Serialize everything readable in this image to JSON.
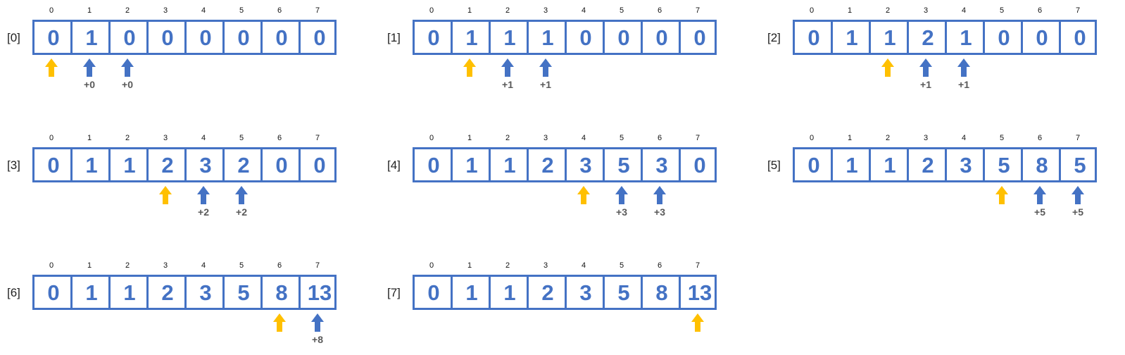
{
  "colors": {
    "array_border": "#4472c4",
    "value_text": "#4472c4",
    "current_pointer": "#ffc000",
    "update_pointer": "#4472c4",
    "delta_text": "#595959"
  },
  "icons": {
    "current": "arrow-up-icon",
    "update": "arrow-up-icon"
  },
  "indices": [
    "0",
    "1",
    "2",
    "3",
    "4",
    "5",
    "6",
    "7"
  ],
  "steps": [
    {
      "label": "[0]",
      "values": [
        "0",
        "1",
        "0",
        "0",
        "0",
        "0",
        "0",
        "0"
      ],
      "current": 0,
      "updates": [
        {
          "index": 1,
          "delta": "+0"
        },
        {
          "index": 2,
          "delta": "+0"
        }
      ]
    },
    {
      "label": "[1]",
      "values": [
        "0",
        "1",
        "1",
        "1",
        "0",
        "0",
        "0",
        "0"
      ],
      "current": 1,
      "updates": [
        {
          "index": 2,
          "delta": "+1"
        },
        {
          "index": 3,
          "delta": "+1"
        }
      ]
    },
    {
      "label": "[2]",
      "values": [
        "0",
        "1",
        "1",
        "2",
        "1",
        "0",
        "0",
        "0"
      ],
      "current": 2,
      "updates": [
        {
          "index": 3,
          "delta": "+1"
        },
        {
          "index": 4,
          "delta": "+1"
        }
      ]
    },
    {
      "label": "[3]",
      "values": [
        "0",
        "1",
        "1",
        "2",
        "3",
        "2",
        "0",
        "0"
      ],
      "current": 3,
      "updates": [
        {
          "index": 4,
          "delta": "+2"
        },
        {
          "index": 5,
          "delta": "+2"
        }
      ]
    },
    {
      "label": "[4]",
      "values": [
        "0",
        "1",
        "1",
        "2",
        "3",
        "5",
        "3",
        "0"
      ],
      "current": 4,
      "updates": [
        {
          "index": 5,
          "delta": "+3"
        },
        {
          "index": 6,
          "delta": "+3"
        }
      ]
    },
    {
      "label": "[5]",
      "values": [
        "0",
        "1",
        "1",
        "2",
        "3",
        "5",
        "8",
        "5"
      ],
      "current": 5,
      "updates": [
        {
          "index": 6,
          "delta": "+5"
        },
        {
          "index": 7,
          "delta": "+5"
        }
      ]
    },
    {
      "label": "[6]",
      "values": [
        "0",
        "1",
        "1",
        "2",
        "3",
        "5",
        "8",
        "13"
      ],
      "current": 6,
      "updates": [
        {
          "index": 7,
          "delta": "+8"
        }
      ]
    },
    {
      "label": "[7]",
      "values": [
        "0",
        "1",
        "1",
        "2",
        "3",
        "5",
        "8",
        "13"
      ],
      "current": 7,
      "updates": []
    }
  ]
}
